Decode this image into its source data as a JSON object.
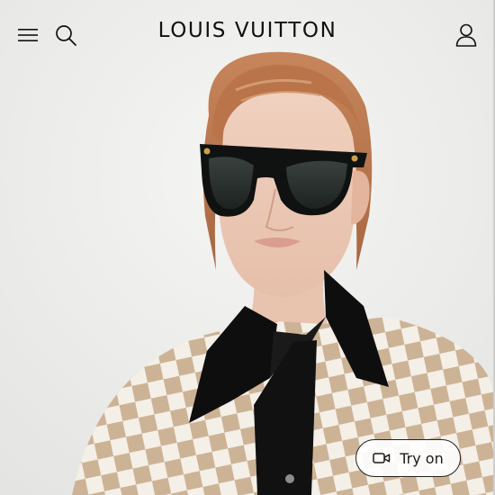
{
  "header": {
    "brand": "LOUIS VUITTON"
  },
  "icons": {
    "menu": "menu-icon",
    "search": "search-icon",
    "account": "account-icon",
    "video": "video-icon"
  },
  "try_on": {
    "label": "Try on"
  },
  "colors": {
    "background": "#eeeeec",
    "text": "#111111",
    "button_border": "#222222"
  }
}
